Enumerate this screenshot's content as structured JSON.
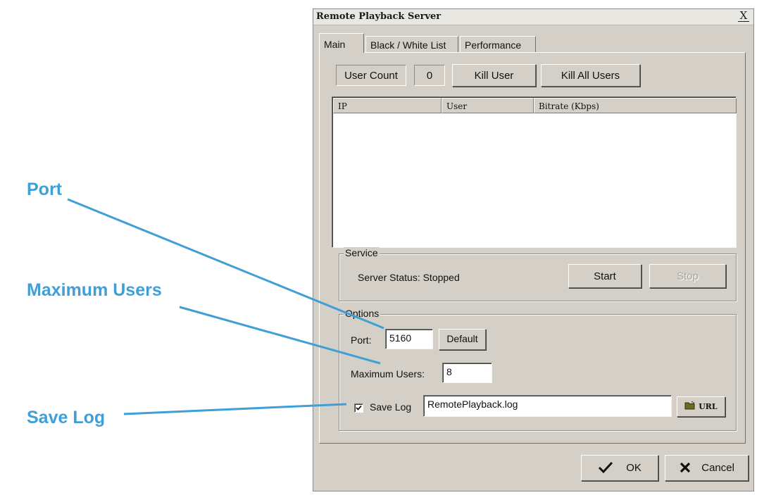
{
  "callouts": {
    "port": "Port",
    "max_users": "Maximum Users",
    "save_log": "Save Log"
  },
  "colors": {
    "callout": "#3f9fd6",
    "dialog_face": "#d4d0c8"
  },
  "dialog": {
    "title": "Remote Playback Server",
    "close_glyph": "X",
    "tabs": [
      {
        "label": "Main",
        "active": true
      },
      {
        "label": "Black / White List",
        "active": false
      },
      {
        "label": "Performance",
        "active": false
      }
    ],
    "main": {
      "user_count_label": "User Count",
      "user_count_value": "0",
      "kill_user": "Kill User",
      "kill_all_users": "Kill All Users",
      "columns": [
        "IP",
        "User",
        "Bitrate (Kbps)"
      ],
      "rows": []
    },
    "service": {
      "title": "Service",
      "status_text": "Server Status: Stopped",
      "start": "Start",
      "stop": "Stop",
      "stop_enabled": false
    },
    "options": {
      "title": "Options",
      "port_label": "Port:",
      "port_value": "5160",
      "default_button": "Default",
      "max_users_label": "Maximum Users:",
      "max_users_value": "8",
      "save_log_checked": true,
      "save_log_label": "Save Log",
      "log_file": "RemotePlayback.log",
      "url_button": "URL",
      "url_icon": "folder-url-icon"
    },
    "footer": {
      "ok": "OK",
      "ok_icon": "checkmark-icon",
      "cancel": "Cancel",
      "cancel_icon": "x-icon"
    }
  }
}
